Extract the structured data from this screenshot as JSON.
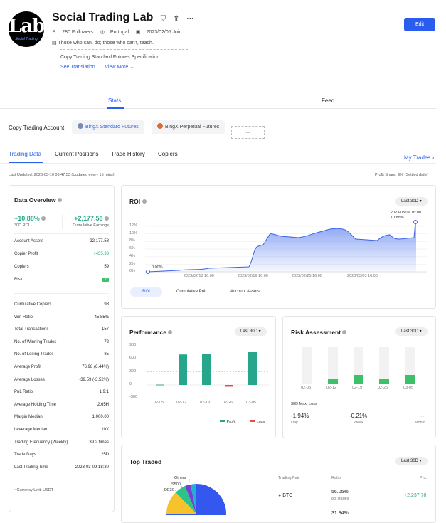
{
  "profile": {
    "avatar_text": "Lab",
    "avatar_sub": "Social Trading",
    "name": "Social Trading Lab",
    "followers": "280 Followers",
    "country": "Portugal",
    "join": "2023/02/05 Join",
    "bio": "Those who can, do; those who can't, teach.",
    "copy_spec": "Copy Trading Standard Futures Specification...",
    "see_translation": "See Translation",
    "view_more": "View More",
    "edit": "Edit"
  },
  "main_tabs": {
    "stats": "Stats",
    "feed": "Feed"
  },
  "copy_accounts": {
    "label": "Copy Trading Account:",
    "standard": "BingX Standard Futures",
    "perpetual": "BingX Perpetual Futures",
    "add": "+"
  },
  "sub_tabs": [
    "Trading Data",
    "Current Positions",
    "Trade History",
    "Copiers"
  ],
  "my_trades": "My Trades",
  "last_updated": "Last Updated: 2023-03-10 06:47:53 (Updated every 15 mins)",
  "profit_share": "Profit Share: 9% (Settled daily)",
  "overview": {
    "title": "Data Overview",
    "roi": "+10.88%",
    "roi_label": "30D ROI",
    "earnings": "+2,177.58",
    "earnings_label": "Cumulative Earnings",
    "rows1": [
      [
        "Account Assets",
        "22,177.58"
      ],
      [
        "Copier Profit",
        "+455.33"
      ],
      [
        "Copiers",
        "59"
      ],
      [
        "Risk",
        "2"
      ]
    ],
    "rows2": [
      [
        "Cumulative Copiers",
        "98"
      ],
      [
        "Win Ratio",
        "45.85%"
      ],
      [
        "Total Transactions",
        "157"
      ],
      [
        "No. of Winning Trades",
        "72"
      ],
      [
        "No. of Losing Trades",
        "85"
      ],
      [
        "Average Profit",
        "76.98 (6.44%)"
      ],
      [
        "Average Losses",
        "-39.59 (-3.52%)"
      ],
      [
        "PnL Ratio",
        "1.9:1"
      ],
      [
        "Average Holding Time",
        "2.65H"
      ],
      [
        "Margin Median",
        "1,000.00"
      ],
      [
        "Leverage Median",
        "10X"
      ],
      [
        "Trading Frequency (Weekly)",
        "39.2 times"
      ],
      [
        "Trade Days",
        "25D"
      ],
      [
        "Last Trading Time",
        "2023-03-09 18:30"
      ]
    ],
    "currency": "Currency Unit: USDT"
  },
  "roi_chart": {
    "title": "ROI",
    "period": "Last 30D",
    "start_label": "0.00%",
    "end_label_date": "2023/03/09 16:00",
    "end_label_val": "10.88%",
    "yticks": [
      "12%",
      "10%",
      "8%",
      "6%",
      "4%",
      "2%",
      "0%"
    ],
    "xticks": [
      "2023/02/13 16:00",
      "2023/02/19 16:00",
      "2023/02/25 16:00",
      "2023/03/03 16:00"
    ],
    "tabs": [
      "ROI",
      "Cumulative PnL",
      "Account Assets"
    ]
  },
  "performance": {
    "title": "Performance",
    "period": "Last 30D",
    "yticks": [
      "900",
      "600",
      "300",
      "0",
      "-300"
    ],
    "xticks": [
      "02-05",
      "02-12",
      "02-19",
      "02-26",
      "03-05"
    ],
    "legend_profit": "Profit",
    "legend_loss": "Loss",
    "profit_color": "#26a68a",
    "loss_color": "#e84a4a",
    "bars": [
      8,
      700,
      720,
      -40,
      760
    ]
  },
  "risk": {
    "title": "Risk Assessment",
    "period": "Last 30D",
    "xticks": [
      "02-05",
      "02-12",
      "02-19",
      "02-26",
      "03-05"
    ],
    "levels": [
      0,
      1,
      2,
      1,
      2
    ],
    "maxloss_label": "30D Max. Loss",
    "day": "-1.94%",
    "week": "-0.21%",
    "month": "--",
    "day_label": "Day",
    "week_label": "Week",
    "month_label": "Month"
  },
  "top_traded": {
    "title": "Top Traded",
    "period": "Last 30D",
    "labels": [
      "Others",
      "US500",
      "DE30"
    ],
    "col_pair": "Trading Pair",
    "col_ratio": "Ratio",
    "col_pnl": "PnL",
    "rows": [
      {
        "pair": "BTC",
        "ratio": "56.05%",
        "trades": "88 Trades",
        "pnl": "+2,237.70"
      },
      {
        "ratio": "31.84%"
      }
    ]
  }
}
